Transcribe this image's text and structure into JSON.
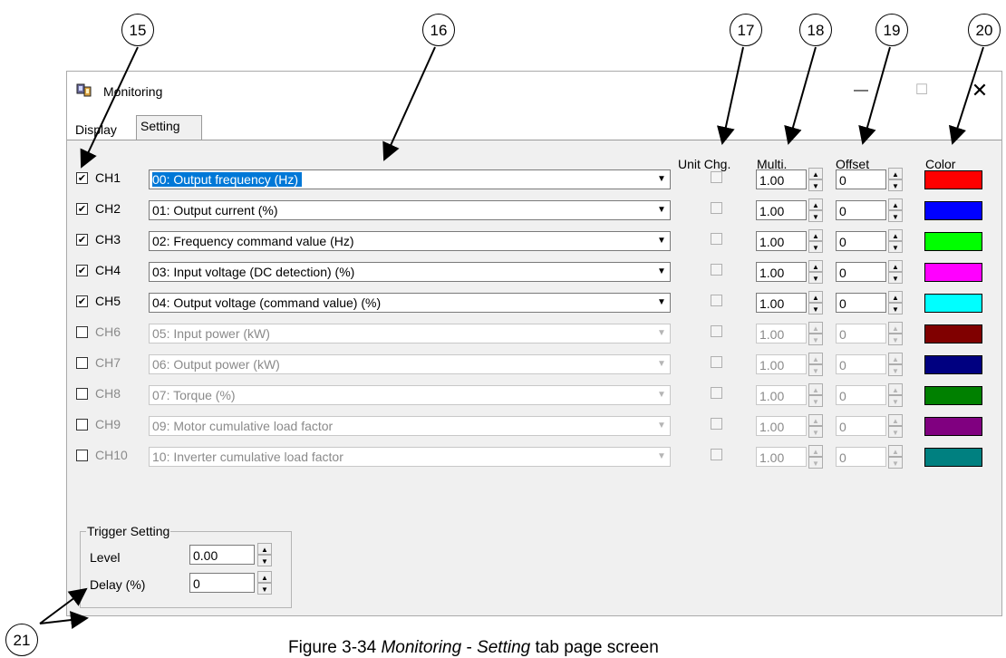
{
  "window": {
    "title": "Monitoring"
  },
  "tabs": [
    {
      "label": "Display"
    },
    {
      "label": "Setting"
    }
  ],
  "column_headers": {
    "unit_chg": "Unit Chg.",
    "multi": "Multi.",
    "offset": "Offset",
    "color": "Color"
  },
  "channels": [
    {
      "label": "CH1",
      "checked": true,
      "item": "00: Output frequency (Hz)",
      "selected": true,
      "multi": "1.00",
      "offset": "0",
      "color": "#ff0000"
    },
    {
      "label": "CH2",
      "checked": true,
      "item": "01: Output current (%)",
      "selected": false,
      "multi": "1.00",
      "offset": "0",
      "color": "#0000ff"
    },
    {
      "label": "CH3",
      "checked": true,
      "item": "02: Frequency command value (Hz)",
      "selected": false,
      "multi": "1.00",
      "offset": "0",
      "color": "#00ff00"
    },
    {
      "label": "CH4",
      "checked": true,
      "item": "03: Input voltage (DC detection) (%)",
      "selected": false,
      "multi": "1.00",
      "offset": "0",
      "color": "#ff00ff"
    },
    {
      "label": "CH5",
      "checked": true,
      "item": "04: Output voltage (command value) (%)",
      "selected": false,
      "multi": "1.00",
      "offset": "0",
      "color": "#00ffff"
    },
    {
      "label": "CH6",
      "checked": false,
      "item": "05: Input power (kW)",
      "selected": false,
      "multi": "1.00",
      "offset": "0",
      "color": "#800000"
    },
    {
      "label": "CH7",
      "checked": false,
      "item": "06: Output power (kW)",
      "selected": false,
      "multi": "1.00",
      "offset": "0",
      "color": "#000080"
    },
    {
      "label": "CH8",
      "checked": false,
      "item": "07: Torque (%)",
      "selected": false,
      "multi": "1.00",
      "offset": "0",
      "color": "#008000"
    },
    {
      "label": "CH9",
      "checked": false,
      "item": "09: Motor cumulative load factor",
      "selected": false,
      "multi": "1.00",
      "offset": "0",
      "color": "#800080"
    },
    {
      "label": "CH10",
      "checked": false,
      "item": "10: Inverter cumulative load factor",
      "selected": false,
      "multi": "1.00",
      "offset": "0",
      "color": "#008080"
    }
  ],
  "trigger": {
    "title": "Trigger Setting",
    "level_label": "Level",
    "level_value": "0.00",
    "delay_label": "Delay (%)",
    "delay_value": "0"
  },
  "callouts": [
    "15",
    "16",
    "17",
    "18",
    "19",
    "20",
    "21"
  ],
  "caption": {
    "prefix": "Figure 3-34 ",
    "italic1": "Monitoring",
    "middle": " - ",
    "italic2": "Setting",
    "suffix": " tab page screen"
  },
  "icons": {
    "app": "monitoring-app-icon",
    "minimize": "minimize-icon",
    "maximize": "maximize-icon",
    "close": "close-icon"
  }
}
